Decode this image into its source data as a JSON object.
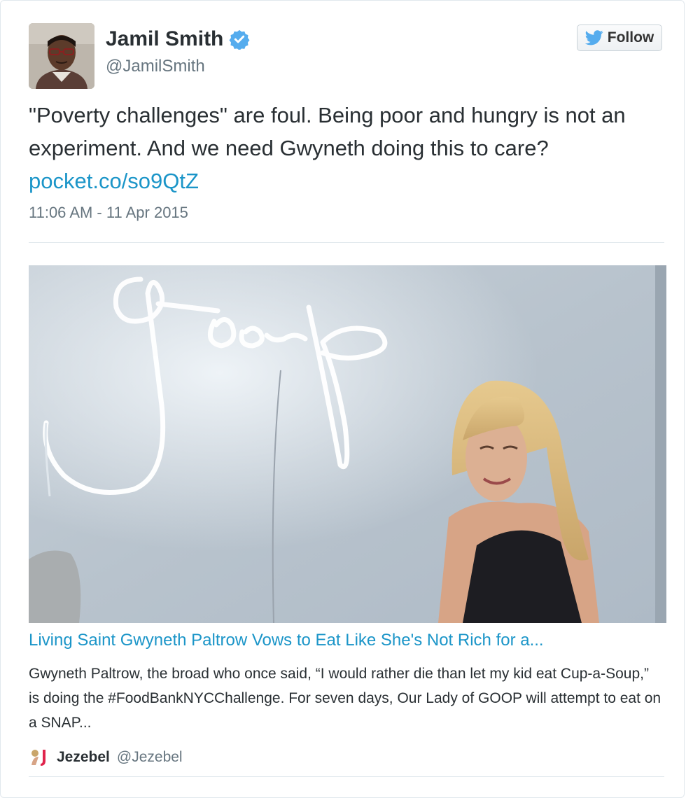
{
  "author": {
    "name": "Jamil Smith",
    "handle": "@JamilSmith",
    "verified": true
  },
  "follow_button": {
    "label": "Follow",
    "icon": "twitter-bird-icon"
  },
  "tweet": {
    "text": "\"Poverty challenges\" are foul. Being poor and hungry is not an experiment. And we need Gwyneth doing this to care? ",
    "link": "pocket.co/so9QtZ",
    "timestamp": "11:06 AM - 11 Apr 2015"
  },
  "card": {
    "title": "Living Saint Gwyneth Paltrow Vows to Eat Like She's Not Rich for a...",
    "description": "Gwyneth Paltrow, the broad who once said, “I would rather die than let my kid eat Cup-a-Soup,” is doing the #FoodBankNYCChallenge. For seven days, Our Lady of GOOP will attempt to eat on a SNAP...",
    "source_name": "Jezebel",
    "source_handle": "@Jezebel"
  },
  "colors": {
    "link": "#1b95c8",
    "text": "#292f33",
    "muted": "#66757f",
    "verified": "#55acee"
  }
}
